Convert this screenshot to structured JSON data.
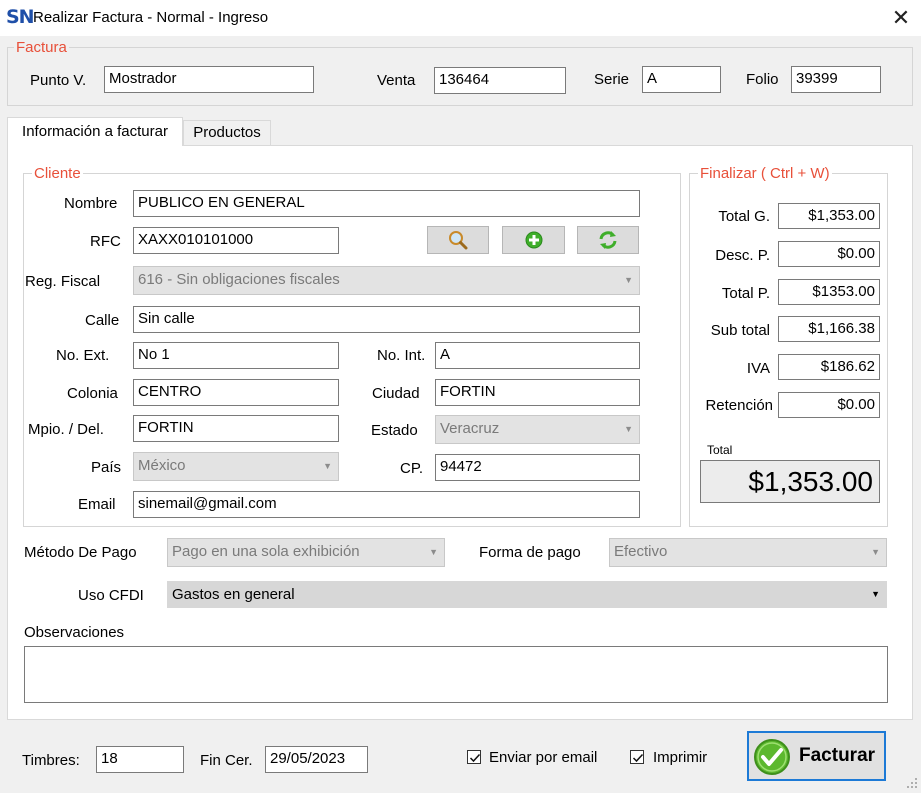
{
  "window": {
    "logo": "SN",
    "title": "Realizar Factura - Normal - Ingreso",
    "close": "✕"
  },
  "factura": {
    "legend": "Factura",
    "punto_v_label": "Punto V.",
    "punto_v_value": "Mostrador",
    "venta_label": "Venta",
    "venta_value": "136464",
    "serie_label": "Serie",
    "serie_value": "A",
    "folio_label": "Folio",
    "folio_value": "39399"
  },
  "tabs": [
    {
      "label": "Información a facturar",
      "active": true
    },
    {
      "label": "Productos",
      "active": false
    }
  ],
  "cliente": {
    "legend": "Cliente",
    "nombre_label": "Nombre",
    "nombre_value": "PUBLICO EN GENERAL",
    "rfc_label": "RFC",
    "rfc_value": "XAXX010101000",
    "reg_fiscal_label": "Reg. Fiscal",
    "reg_fiscal_value": "616 - Sin obligaciones fiscales",
    "calle_label": "Calle",
    "calle_value": "Sin calle",
    "no_ext_label": "No. Ext.",
    "no_ext_value": "No 1",
    "no_int_label": "No. Int.",
    "no_int_value": "A",
    "colonia_label": "Colonia",
    "colonia_value": "CENTRO",
    "ciudad_label": "Ciudad",
    "ciudad_value": "FORTIN",
    "mpio_label": "Mpio. / Del.",
    "mpio_value": "FORTIN",
    "estado_label": "Estado",
    "estado_value": "Veracruz",
    "pais_label": "País",
    "pais_value": "México",
    "cp_label": "CP.",
    "cp_value": "94472",
    "email_label": "Email",
    "email_value": "sinemail@gmail.com",
    "icons": [
      "search-icon",
      "add-icon",
      "refresh-icon"
    ]
  },
  "finalizar": {
    "legend": "Finalizar ( Ctrl + W)",
    "total_g_label": "Total G.",
    "total_g_value": "$1,353.00",
    "desc_p_label": "Desc. P.",
    "desc_p_value": "$0.00",
    "total_p_label": "Total P.",
    "total_p_value": "$1353.00",
    "subtotal_label": "Sub total",
    "subtotal_value": "$1,166.38",
    "iva_label": "IVA",
    "iva_value": "$186.62",
    "retencion_label": "Retención",
    "retencion_value": "$0.00",
    "total_label": "Total",
    "total_value": "$1,353.00"
  },
  "pago": {
    "metodo_label": "Método De Pago",
    "metodo_value": "Pago en una sola exhibición",
    "forma_label": "Forma de pago",
    "forma_value": "Efectivo",
    "uso_label": "Uso CFDI",
    "uso_value": "Gastos en general",
    "observaciones_label": "Observaciones",
    "observaciones_value": ""
  },
  "footer": {
    "timbres_label": "Timbres:",
    "timbres_value": "18",
    "fin_cer_label": "Fin Cer.",
    "fin_cer_value": "29/05/2023",
    "enviar_email_label": "Enviar por email",
    "enviar_email_checked": true,
    "imprimir_label": "Imprimir",
    "imprimir_checked": true,
    "facturar_label": "Facturar"
  },
  "colors": {
    "legend": "#e8503a",
    "accent_border": "#1d7ad6",
    "check_green": "#5cb82e"
  }
}
